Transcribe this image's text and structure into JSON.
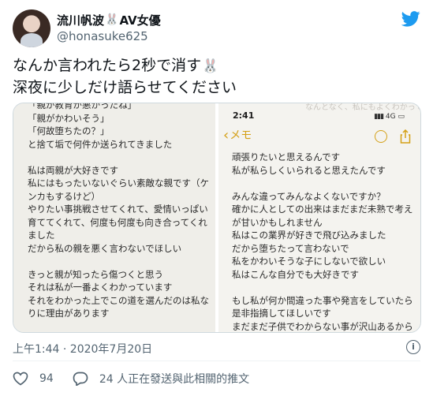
{
  "tweet": {
    "author_name": "流川帆波",
    "author_name_rabbit": "🐰",
    "author_name_suffix": "AV女優",
    "handle": "@honasuke625",
    "text_line1": "なんか言われたら2秒で消す",
    "text_line1_rabbit": "🐰",
    "text_line2": "深夜に少しだけ語らせてください",
    "timestamp": "上午1:44 · 2020年7月20日",
    "info_label": "i",
    "likes_count": "94",
    "conversation_text": "24 人正在發送與此相關的推文"
  },
  "media": {
    "left_panel": {
      "lines": [
        "「親が教育が悪かったね」",
        "「親がかわいそう」",
        "「何故堕ちたの？」",
        "と捨て垢で何件か送られてきました",
        "",
        "私は両親が大好きです",
        "私にはもったいないぐらい素敵な親です（ケ",
        "ンカもするけど）",
        "やりたい事挑戦させてくれて、愛情いっぱい",
        "育ててくれて、何度も何度も向き合ってくれ",
        "ました",
        "だから私の親を悪く言わないでほしい",
        "",
        "きっと親が知ったら傷つくと思う",
        "それは私が一番よくわかっています",
        "それをわかった上でこの道を選んだのは私な",
        "りに理由があります"
      ]
    },
    "right_panel": {
      "status_time": "2:41",
      "status_network": "4G",
      "back_label": "メモ",
      "faded_top": "なんとなく、私にもよくわかっている",
      "lines": [
        "頑張りたいと思えるんです",
        "私が私らしくいられると思えたんです",
        "",
        "みんな違ってみんなよくないですか？",
        "確かに人としての出来はまだまだ未熟で考え",
        "が甘いかもしれません",
        "私はこの業界が好きで飛び込みました",
        "だから堕ちたって言わないで",
        "私をかわいそうな子にしないで欲しい",
        "私はこんな自分でも大好きです",
        "",
        "もし私が何か間違った事や発言をしていたら",
        "是非指摘してほしいです",
        "まだまだ子供でわからない事が沢山あるから"
      ]
    }
  },
  "colors": {
    "twitter_blue": "#1d9bf0",
    "notes_yellow": "#d4a017",
    "secondary_text": "#536471"
  },
  "icons": [
    "twitter-bird-icon",
    "rabbit-emoji",
    "chevron-left-icon",
    "person-circle-icon",
    "share-icon",
    "info-icon",
    "heart-icon",
    "conversation-icon"
  ]
}
